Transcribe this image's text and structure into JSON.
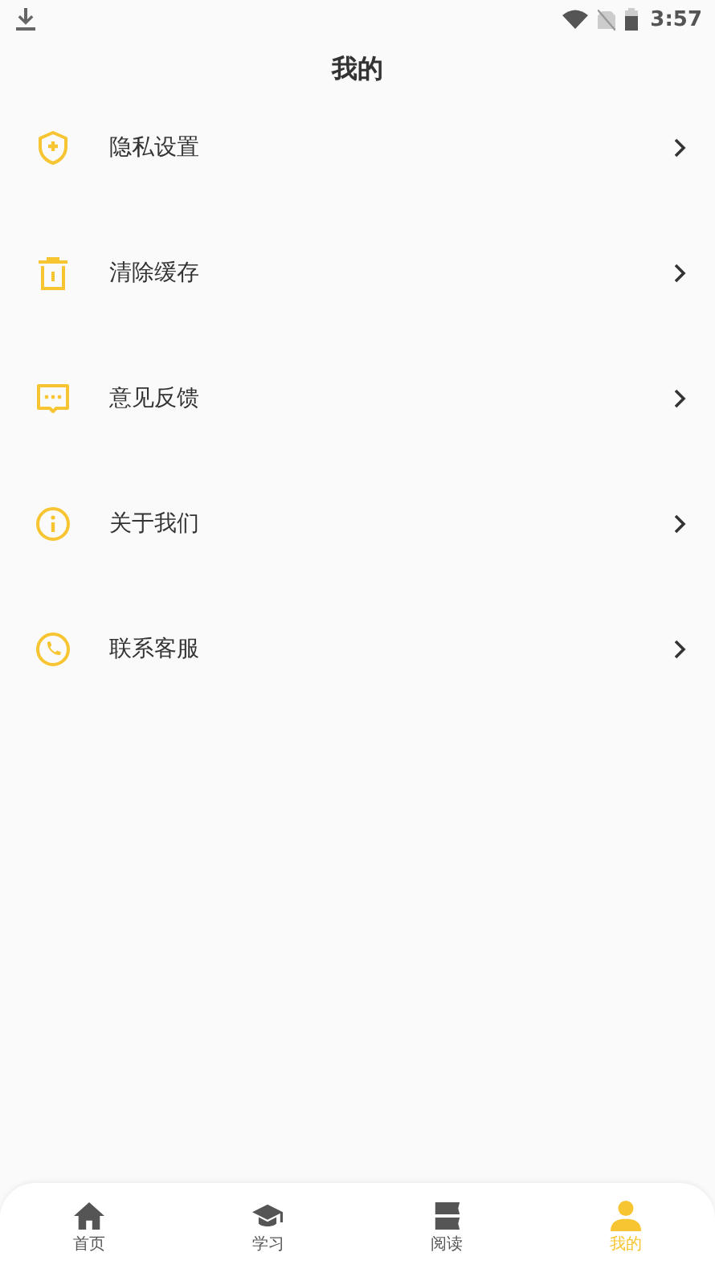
{
  "status_bar": {
    "time": "3:57"
  },
  "title": "我的",
  "menu": [
    {
      "kind": "privacy",
      "label": "隐私设置"
    },
    {
      "kind": "trash",
      "label": "清除缓存"
    },
    {
      "kind": "feedback",
      "label": "意见反馈"
    },
    {
      "kind": "info",
      "label": "关于我们"
    },
    {
      "kind": "phone",
      "label": "联系客服"
    }
  ],
  "tabs": [
    {
      "kind": "home",
      "label": "首页",
      "selected": false
    },
    {
      "kind": "study",
      "label": "学习",
      "selected": false
    },
    {
      "kind": "read",
      "label": "阅读",
      "selected": false
    },
    {
      "kind": "me",
      "label": "我的",
      "selected": true
    }
  ]
}
